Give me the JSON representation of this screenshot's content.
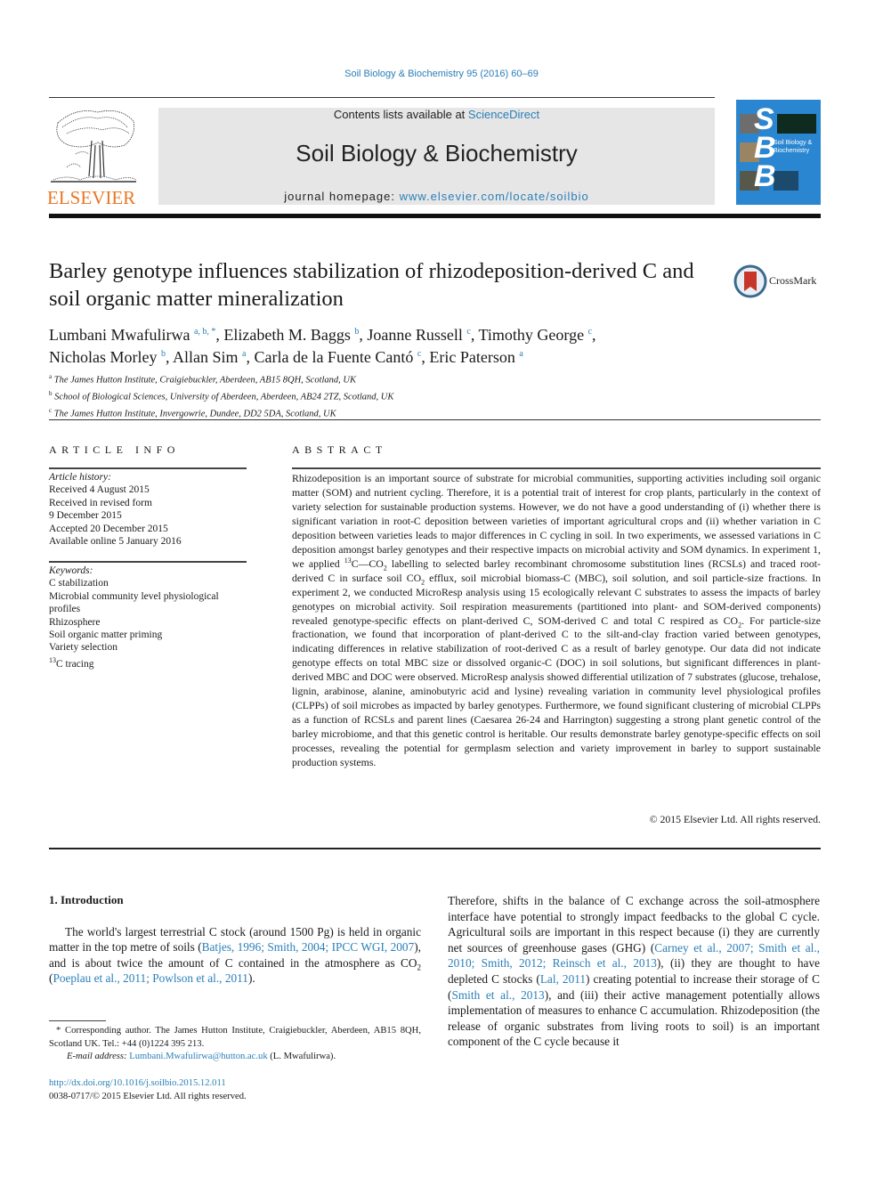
{
  "header": {
    "running_head": "Soil Biology & Biochemistry 95 (2016) 60–69",
    "publisher_logo_text": "ELSEVIER",
    "contents_prefix": "Contents lists available at ",
    "contents_link": "ScienceDirect",
    "journal_title": "Soil Biology & Biochemistry",
    "homepage_prefix": "journal homepage: ",
    "homepage_link": "www.elsevier.com/locate/soilbio",
    "cover_letters": [
      "S",
      "B",
      "B"
    ],
    "cover_title": "Soil Biology & Biochemistry",
    "brand_color": "#2a86d0",
    "elsevier_color": "#e87722",
    "link_color": "#2a7fb8"
  },
  "article": {
    "title": "Barley genotype influences stabilization of rhizodeposition-derived C and soil organic matter mineralization",
    "crossmark_label": "CrossMark",
    "authors": [
      {
        "name": "Lumbani Mwafulirwa",
        "sup": "a, b, *",
        "sep": ", "
      },
      {
        "name": "Elizabeth M. Baggs",
        "sup": "b",
        "sep": ", "
      },
      {
        "name": "Joanne Russell",
        "sup": "c",
        "sep": ", "
      },
      {
        "name": "Timothy George",
        "sup": "c",
        "sep": ","
      },
      {
        "name": "Nicholas Morley",
        "sup": "b",
        "sep": ", "
      },
      {
        "name": "Allan Sim",
        "sup": "a",
        "sep": ", "
      },
      {
        "name": "Carla de la Fuente Cantó",
        "sup": "c",
        "sep": ", "
      },
      {
        "name": "Eric Paterson",
        "sup": "a",
        "sep": ""
      }
    ],
    "affiliations": [
      {
        "key": "a",
        "text": "The James Hutton Institute, Craigiebuckler, Aberdeen, AB15 8QH, Scotland, UK"
      },
      {
        "key": "b",
        "text": "School of Biological Sciences, University of Aberdeen, Aberdeen, AB24 2TZ, Scotland, UK"
      },
      {
        "key": "c",
        "text": "The James Hutton Institute, Invergowrie, Dundee, DD2 5DA, Scotland, UK"
      }
    ]
  },
  "article_info": {
    "heading": "ARTICLE INFO",
    "history_label": "Article history:",
    "history": [
      "Received 4 August 2015",
      "Received in revised form",
      "9 December 2015",
      "Accepted 20 December 2015",
      "Available online 5 January 2016"
    ],
    "keywords_label": "Keywords:",
    "keywords": [
      "C stabilization",
      "Microbial community level physiological profiles",
      "Rhizosphere",
      "Soil organic matter priming",
      "Variety selection"
    ],
    "keyword_last_sup": "13",
    "keyword_last": "C tracing"
  },
  "abstract": {
    "heading": "ABSTRACT",
    "part1": "Rhizodeposition is an important source of substrate for microbial communities, supporting activities including soil organic matter (SOM) and nutrient cycling. Therefore, it is a potential trait of interest for crop plants, particularly in the context of variety selection for sustainable production systems. However, we do not have a good understanding of (i) whether there is significant variation in root-C deposition between varieties of important agricultural crops and (ii) whether variation in C deposition between varieties leads to major differences in C cycling in soil. In two experiments, we assessed variations in C deposition amongst barley genotypes and their respective impacts on microbial activity and SOM dy­namics. In experiment 1, we applied ",
    "sup13": "13",
    "part2": "C—CO",
    "sub2a": "2",
    "part3": " labelling to selected barley recombinant chromosome substitution lines (RCSLs) and traced root-derived C in surface soil CO",
    "sub2b": "2",
    "part4": " efflux, soil microbial biomass-C (MBC), soil solution, and soil particle-size fractions. In experiment 2, we conducted MicroResp analysis using 15 ecologically relevant C substrates to assess the impacts of barley genotypes on microbial activity. Soil respiration measurements (partitioned into plant- and SOM-derived components) revealed genotype-specific effects on plant-derived C, SOM-derived C and total C respired as CO",
    "sub2c": "2",
    "part5": ". For particle-size fractionation, we found that incorporation of plant-derived C to the silt-and-clay fraction varied between genotypes, indicating differences in relative stabilization of root-derived C as a result of barley genotype. Our data did not indicate genotype effects on total MBC size or dissolved organic-C (DOC) in soil solu­tions, but significant differences in plant-derived MBC and DOC were observed. MicroResp analysis showed differential utilization of 7 substrates (glucose, trehalose, lignin, arabinose, alanine, aminobutyric acid and lysine) revealing variation in community level physiological profiles (CLPPs) of soil microbes as impacted by barley genotypes. Furthermore, we found significant clustering of microbial CLPPs as a function of RCSLs and parent lines (Caesarea 26-24 and Harrington) suggesting a strong plant genetic control of the barley microbiome, and that this genetic control is heritable. Our results demonstrate barley genotype-specific effects on soil processes, revealing the potential for germplasm selection and variety improvement in barley to support sustainable production systems.",
    "copyright": "© 2015 Elsevier Ltd. All rights reserved."
  },
  "introduction": {
    "heading": "1.  Introduction",
    "left": {
      "t1": "The world's largest terrestrial C stock (around 1500 Pg) is held in organic matter in the top metre of soils (",
      "c1": "Batjes, 1996; Smith, 2004; IPCC WGI, 2007",
      "t2": "), and is about twice the amount of C contained in the atmosphere as CO",
      "sub": "2",
      "t3": " (",
      "c2": "Poeplau et al., 2011; Powlson et al., 2011",
      "t4": ")."
    },
    "right": {
      "t1": "Therefore, shifts in the balance of C exchange across the soil-atmosphere interface have potential to strongly impact feedbacks to the global C cycle. Agricultural soils are important in this respect because (i) they are currently net sources of greenhouse gases (GHG) (",
      "c1": "Carney et al., 2007; Smith et al., 2010; Smith, 2012; Reinsch et al., 2013",
      "t2": "), (ii) they are thought to have depleted C stocks (",
      "c2": "Lal, 2011",
      "t3": ") creating potential to increase their storage of C (",
      "c3": "Smith et al., 2013",
      "t4": "), and (iii) their active management potentially allows implementation of measures to enhance C accumulation. Rhizo­deposition (the release of organic substrates from living roots to soil) is an important component of the C cycle because it"
    }
  },
  "footer": {
    "footnote_text": "* Corresponding author. The James Hutton Institute, Craigiebuckler, Aberdeen, AB15 8QH, Scotland UK. Tel.: +44 (0)1224 395 213.",
    "email_label": "E-mail address:",
    "email": "Lumbani.Mwafulirwa@hutton.ac.uk",
    "email_suffix": " (L. Mwafulirwa).",
    "doi": "http://dx.doi.org/10.1016/j.soilbio.2015.12.011",
    "issn": "0038-0717/© 2015 Elsevier Ltd. All rights reserved."
  }
}
